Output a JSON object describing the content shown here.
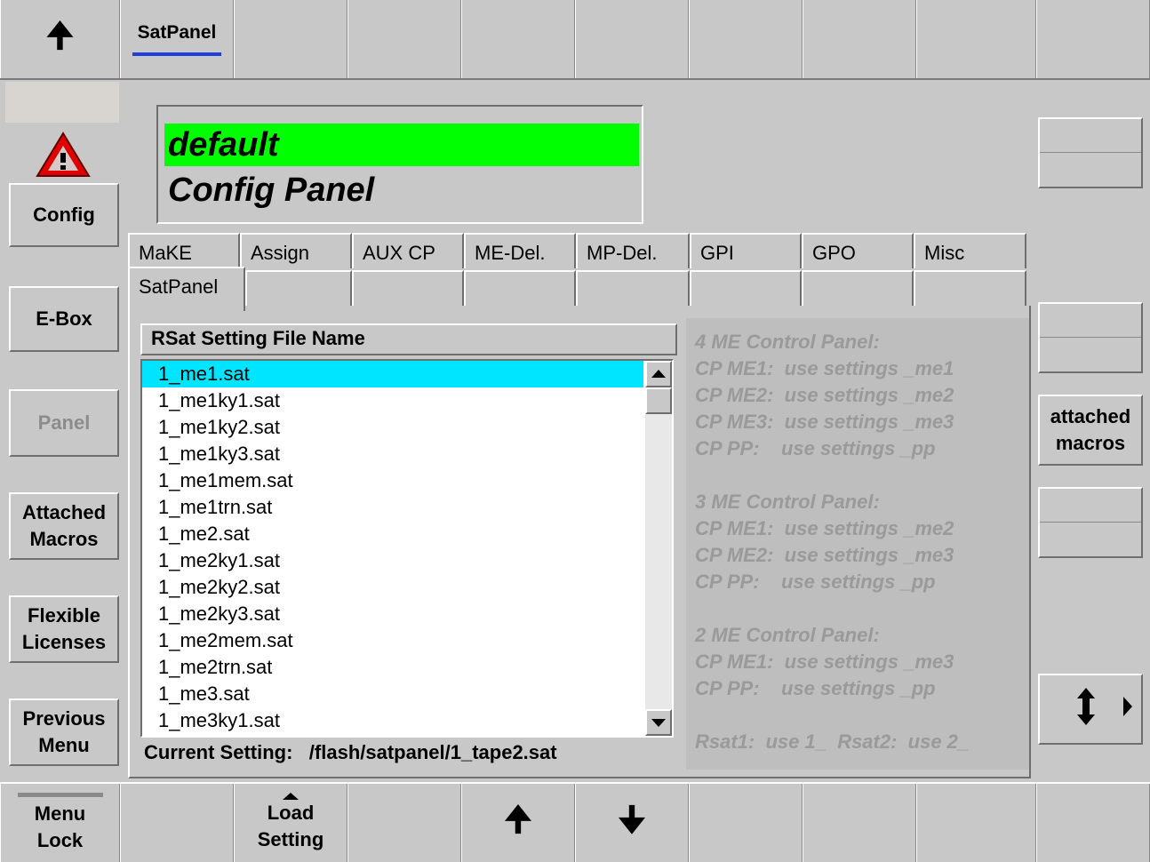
{
  "topbar": {
    "up_icon": "up-arrow-icon",
    "active_tab": "SatPanel",
    "accent_color": "#1f3fd8"
  },
  "header": {
    "line1": "default",
    "line2": "Config Panel",
    "highlight_color": "#00ff00"
  },
  "left_menu": {
    "warning_icon": "warning-triangle-icon",
    "config": "Config",
    "ebox": "E-Box",
    "panel": "Panel",
    "attached_macros_1": "Attached",
    "attached_macros_2": "Macros",
    "flexible_licenses_1": "Flexible",
    "flexible_licenses_2": "Licenses",
    "previous_menu_1": "Previous",
    "previous_menu_2": "Menu"
  },
  "tabs_row1": [
    "MaKE",
    "Assign",
    "AUX CP",
    "ME-Del.",
    "MP-Del.",
    "GPI",
    "GPO",
    "Misc"
  ],
  "tabs_row2": [
    "SatPanel",
    "",
    "",
    "",
    "",
    "",
    "",
    ""
  ],
  "list": {
    "header": "RSat Setting File Name",
    "items": [
      "1_me1.sat",
      "1_me1ky1.sat",
      "1_me1ky2.sat",
      "1_me1ky3.sat",
      "1_me1mem.sat",
      "1_me1trn.sat",
      "1_me2.sat",
      "1_me2ky1.sat",
      "1_me2ky2.sat",
      "1_me2ky3.sat",
      "1_me2mem.sat",
      "1_me2trn.sat",
      "1_me3.sat",
      "1_me3ky1.sat"
    ],
    "selected_index": 0,
    "selected_color": "#00e5ff",
    "current_label": "Current Setting:",
    "current_value": "/flash/satpanel/1_tape2.sat"
  },
  "info": {
    "lines": [
      "4 ME Control Panel:",
      "CP ME1:  use settings _me1",
      "CP ME2:  use settings _me2",
      "CP ME3:  use settings _me3",
      "CP PP:    use settings _pp",
      "",
      "3 ME Control Panel:",
      "CP ME1:  use settings _me2",
      "CP ME2:  use settings _me3",
      "CP PP:    use settings _pp",
      "",
      "2 ME Control Panel:",
      "CP ME1:  use settings _me3",
      "CP PP:    use settings _pp",
      "",
      "Rsat1:  use 1_  Rsat2:  use 2_"
    ]
  },
  "right_menu": {
    "attached_macros_1": "attached",
    "attached_macros_2": "macros",
    "updown_icon": "up-down-arrow-icon",
    "right_icon": "right-triangle-icon"
  },
  "bottombar": {
    "menu_lock_1": "Menu",
    "menu_lock_2": "Lock",
    "load_setting_1": "Load",
    "load_setting_2": "Setting",
    "up_icon": "up-arrow-icon",
    "down_icon": "down-arrow-icon"
  }
}
